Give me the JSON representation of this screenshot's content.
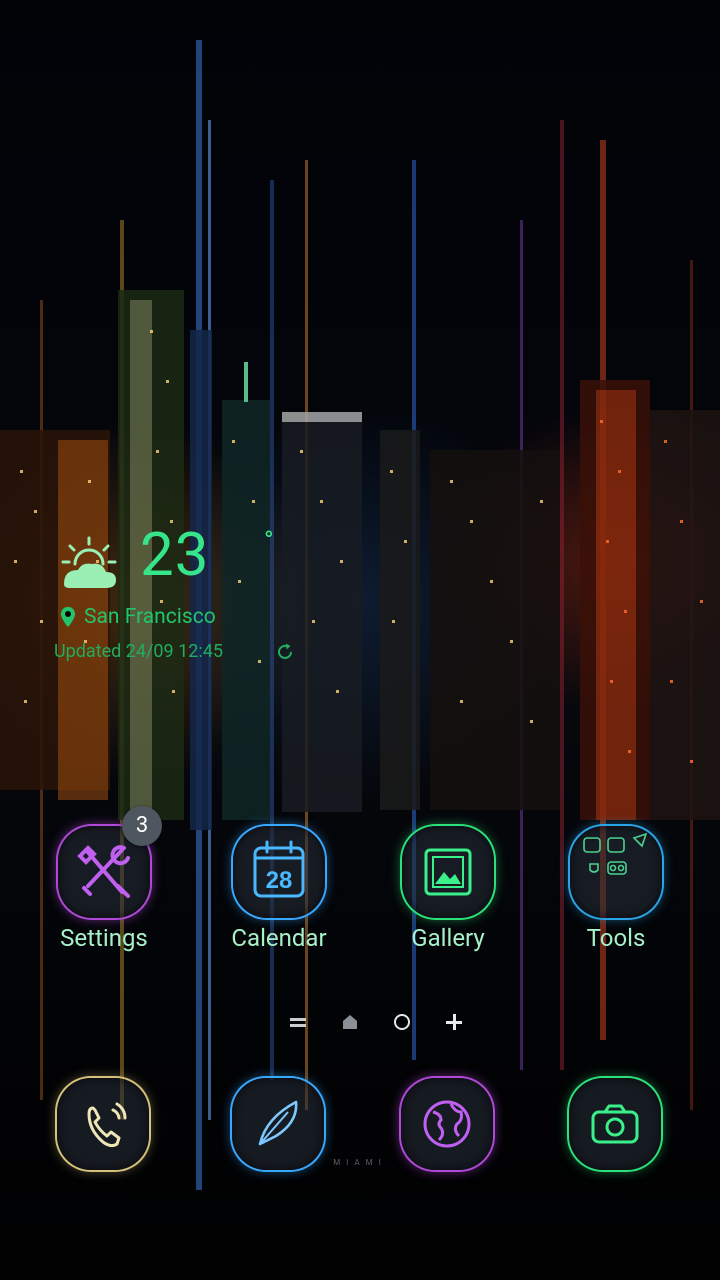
{
  "weather": {
    "temperature": "23",
    "unit": "°",
    "city": "San Francisco",
    "updated": "Updated 24/09 12:45",
    "icon": "partly-cloudy-icon",
    "color": "#36e58a"
  },
  "apps": [
    {
      "label": "Settings",
      "icon": "settings-tools-icon",
      "badge": "3",
      "glow": "#b048d8"
    },
    {
      "label": "Calendar",
      "icon": "calendar-icon",
      "date": "28",
      "glow": "#38a8ff"
    },
    {
      "label": "Gallery",
      "icon": "gallery-icon",
      "glow": "#2ce07a"
    },
    {
      "label": "Tools",
      "icon": "tools-folder-icon",
      "glow": "#2aa4e8"
    }
  ],
  "page_indicator": {
    "items": [
      "menu-icon",
      "home-icon",
      "page-dot-icon",
      "add-page-icon"
    ]
  },
  "dock": [
    {
      "icon": "phone-icon",
      "glow": "#d4c27a"
    },
    {
      "icon": "messages-feather-icon",
      "glow": "#38a8ff"
    },
    {
      "icon": "browser-globe-icon",
      "glow": "#b048d8"
    },
    {
      "icon": "camera-icon",
      "glow": "#2ce07a"
    }
  ],
  "wallpaper_caption": "MIAMI"
}
